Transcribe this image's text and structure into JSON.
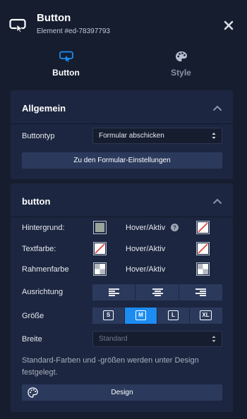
{
  "header": {
    "title": "Button",
    "subtitle": "Element #ed-78397793",
    "element_icon": "button-element-icon",
    "close_icon": "close-icon"
  },
  "tabs": [
    {
      "label": "Button",
      "icon": "button-element-icon",
      "active": true
    },
    {
      "label": "Style",
      "icon": "palette-icon",
      "active": false
    }
  ],
  "allgemein": {
    "title": "Allgemein",
    "buttontyp_label": "Buttontyp",
    "buttontyp_value": "Formular abschicken",
    "form_settings_button": "Zu den Formular-Einstellungen"
  },
  "button_panel": {
    "title": "button",
    "hintergrund_label": "Hintergrund:",
    "hover_aktiv_label": "Hover/Aktiv",
    "textfarbe_label": "Textfarbe:",
    "rahmenfarbe_label": "Rahmenfarbe",
    "ausrichtung_label": "Ausrichtung",
    "groesse_label": "Größe",
    "breite_label": "Breite",
    "breite_value": "Standard",
    "sizes": [
      "S",
      "M",
      "L",
      "XL"
    ],
    "active_size": "M",
    "note": "Standard-Farben und -größen werden unter Design festgelegt.",
    "design_button": "Design"
  },
  "colors": {
    "background": "#151d2f",
    "panel": "#1c2640",
    "control": "#2b3a5c",
    "accent": "#1c8cf2",
    "hintergrund_swatch": "#9aa39c",
    "none_swatch_line": "#e0463c"
  }
}
